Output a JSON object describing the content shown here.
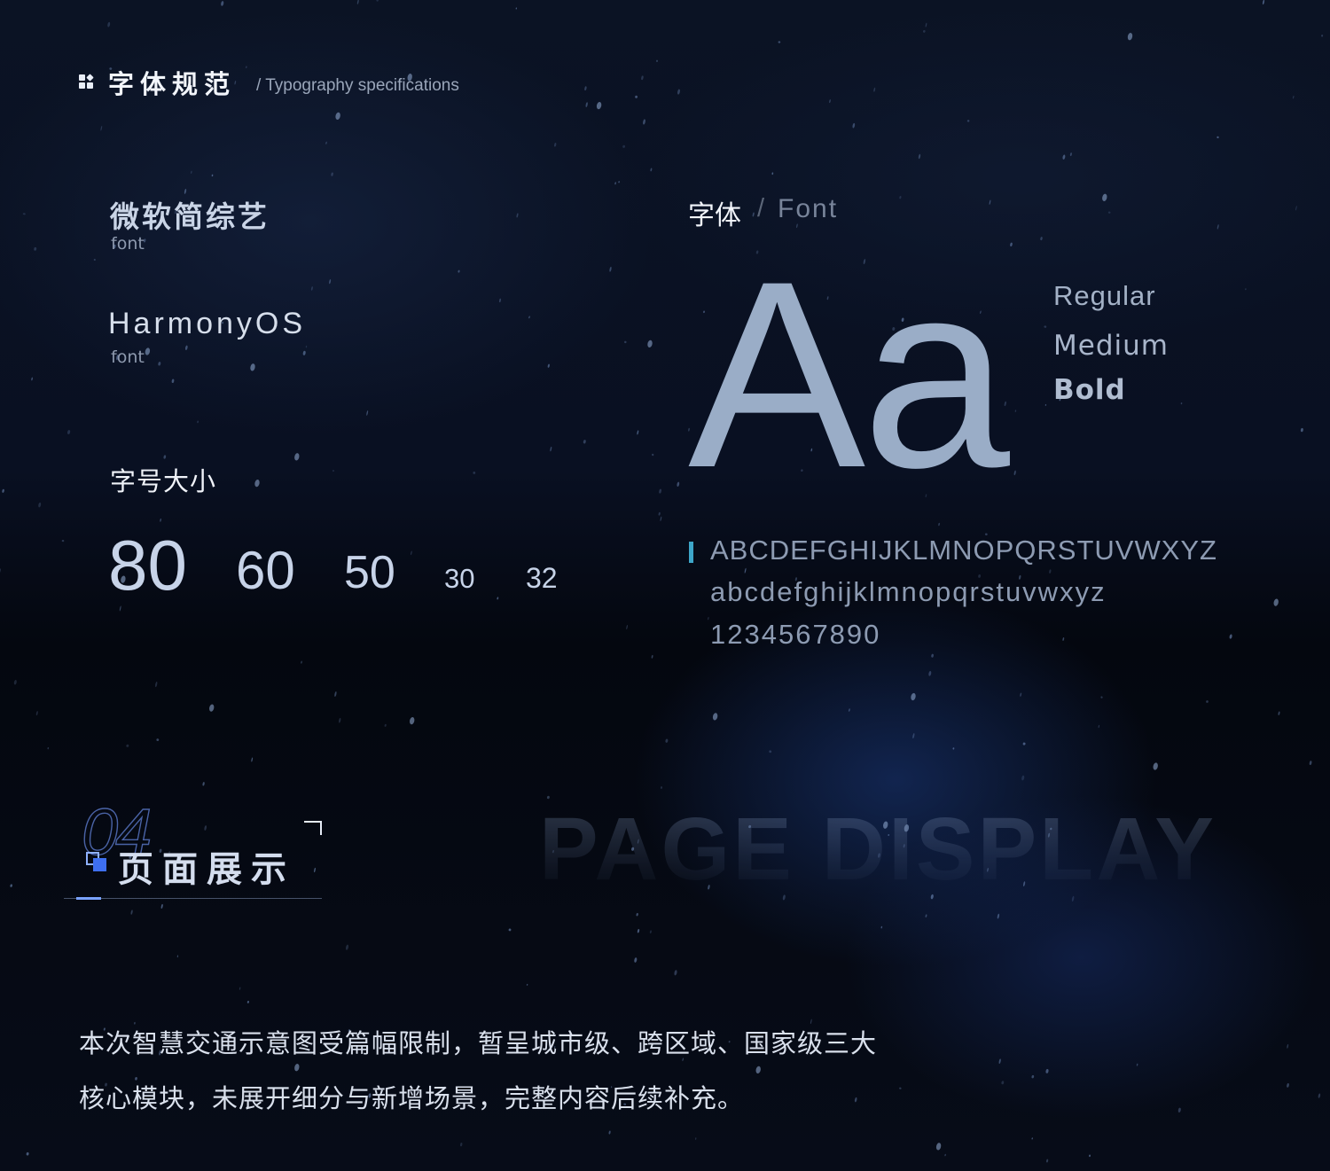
{
  "header": {
    "title": "字体规范",
    "subtitle": "/ Typography specifications"
  },
  "fonts": [
    {
      "name": "微软简综艺",
      "caption": "font"
    },
    {
      "name": "HarmonyOS",
      "caption": "font"
    }
  ],
  "sizes": {
    "title": "字号大小",
    "values": [
      "80",
      "60",
      "50",
      "30",
      "32"
    ]
  },
  "specimen": {
    "label": "字体",
    "separator": "/",
    "label_en": "Font",
    "glyph": "Aa",
    "weights": [
      "Regular",
      "Medium",
      "Bold"
    ],
    "uppercase": "ABCDEFGHIJKLMNOPQRSTUVWXYZ",
    "lowercase": "abcdefghijklmnopqrstuvwxyz",
    "digits": "1234567890"
  },
  "section": {
    "number": "04",
    "title": "页面展示",
    "ghost_text": "PAGE DISPLAY",
    "description": [
      "本次智慧交通示意图受篇幅限制，暂呈城市级、跨区域、国家级三大",
      "核心模块，未展开细分与新增场景，完整内容后续补充。"
    ]
  },
  "colors": {
    "background": "#04060d",
    "accent_bar": "#3da6c9",
    "accent_blue": "#3e6ff0",
    "specimen_glyph": "#9aadc7"
  },
  "icons": [
    "grid-icon",
    "square-icon",
    "corner-bracket-icon"
  ]
}
